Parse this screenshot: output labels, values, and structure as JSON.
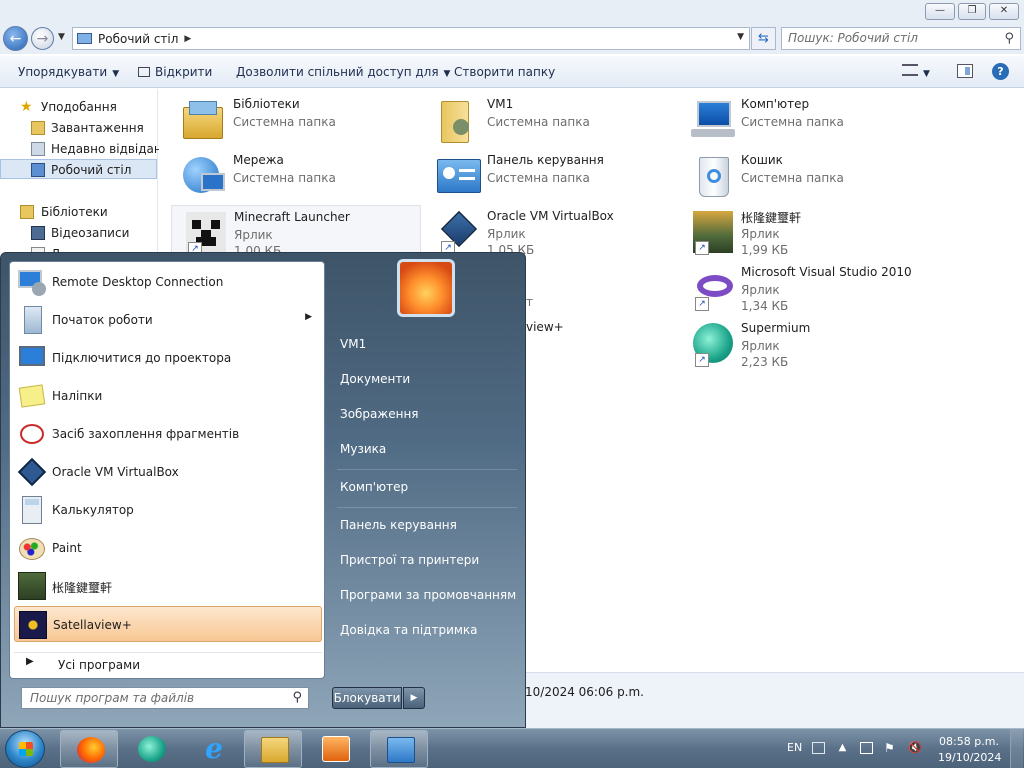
{
  "window": {
    "address": "Робочий стіл",
    "search_placeholder": "Пошук: Робочий стіл",
    "min_glyph": "—",
    "max_glyph": "❐",
    "close_glyph": "✕"
  },
  "toolbar": {
    "organize": "Упорядкувати",
    "open": "Відкрити",
    "share": "Дозволити спільний доступ для",
    "new_folder": "Створити папку"
  },
  "navpane": {
    "favorites": "Уподобання",
    "downloads": "Завантаження",
    "recent": "Недавно відвідане",
    "desktop": "Робочий стіл",
    "libraries": "Бібліотеки",
    "videos": "Відеозаписи",
    "partial": "Д"
  },
  "items": [
    {
      "name": "Бібліотеки",
      "sub": "Системна папка",
      "size": ""
    },
    {
      "name": "VM1",
      "sub": "Системна папка",
      "size": ""
    },
    {
      "name": "Комп'ютер",
      "sub": "Системна папка",
      "size": ""
    },
    {
      "name": "Мережа",
      "sub": "Системна папка",
      "size": ""
    },
    {
      "name": "Панель керування",
      "sub": "Системна папка",
      "size": ""
    },
    {
      "name": "Кошик",
      "sub": "Системна папка",
      "size": ""
    },
    {
      "name": "Minecraft Launcher",
      "sub": "Ярлик",
      "size": "1,00 КБ"
    },
    {
      "name": "Oracle VM VirtualBox",
      "sub": "Ярлик",
      "size": "1,05 КБ"
    },
    {
      "name": "枨隆鍵璽軒",
      "sub": "Ярлик",
      "size": "1,99 КБ"
    },
    {
      "name": "Microsoft Visual Studio 2010",
      "sub": "Ярлик",
      "size": "1,34 КБ"
    },
    {
      "name": "Supermium",
      "sub": "Ярлик",
      "size": "2,23 КБ"
    }
  ],
  "partial_text": {
    "t": "т",
    "view": "view+"
  },
  "details": {
    "date": "10/2024 06:06 p.m."
  },
  "startmenu": {
    "programs": [
      {
        "label": "Remote Desktop Connection"
      },
      {
        "label": "Початок роботи",
        "arrow": "▶"
      },
      {
        "label": "Підключитися до проектора"
      },
      {
        "label": "Наліпки"
      },
      {
        "label": "Засіб захоплення фрагментів"
      },
      {
        "label": "Oracle VM VirtualBox"
      },
      {
        "label": "Калькулятор"
      },
      {
        "label": "Paint"
      },
      {
        "label": "枨隆鍵璽軒"
      },
      {
        "label": "Satellaview+"
      }
    ],
    "all_programs": "Усі програми",
    "search_placeholder": "Пошук програм та файлів",
    "links": [
      "VM1",
      "Документи",
      "Зображення",
      "Музика",
      "Комп'ютер",
      "Панель керування",
      "Пристрої та принтери",
      "Програми за промовчанням",
      "Довідка та підтримка"
    ],
    "lock": "Блокувати"
  },
  "taskbar": {
    "lang": "EN",
    "time": "08:58 p.m.",
    "date": "19/10/2024"
  },
  "colors": {
    "startmenu_top": "#3e5468",
    "highlight": "#f8c793",
    "taskbar": "#5b7189"
  }
}
